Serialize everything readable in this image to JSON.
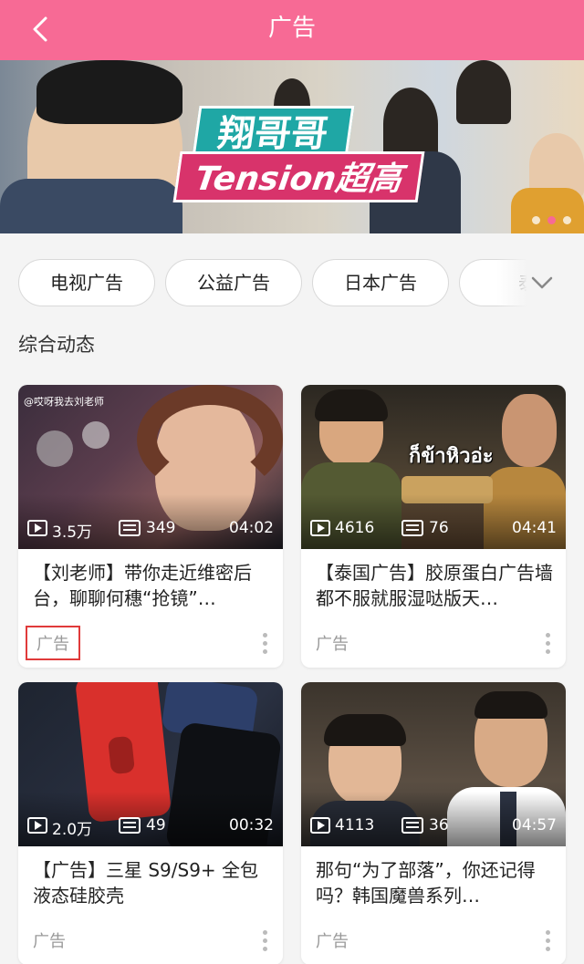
{
  "header": {
    "title": "广告"
  },
  "banner": {
    "logo_line1": "翔哥哥",
    "logo_line2": "Tension超高",
    "slides": 3,
    "active_slide": 2
  },
  "categories": [
    {
      "label": "电视广告"
    },
    {
      "label": "公益广告"
    },
    {
      "label": "日本广告"
    },
    {
      "label": "泰"
    }
  ],
  "section": {
    "title": "综合动态"
  },
  "videos": [
    {
      "plays": "3.5万",
      "comments": "349",
      "duration": "04:02",
      "title": "【刘老师】带你走近维密后台，聊聊何穗“抢镜”…",
      "tag": "广告",
      "watermark": "@哎呀我去刘老师"
    },
    {
      "plays": "4616",
      "comments": "76",
      "duration": "04:41",
      "title": "【泰国广告】胶原蛋白广告墙都不服就服湿哒版天…",
      "tag": "广告",
      "caption": "ก็ข้าหิวอ่ะ"
    },
    {
      "plays": "2.0万",
      "comments": "49",
      "duration": "00:32",
      "title": "【广告】三星 S9/S9+ 全包液态硅胶壳",
      "tag": "广告"
    },
    {
      "plays": "4113",
      "comments": "36",
      "duration": "04:57",
      "title": "那句“为了部落”，你还记得吗？韩国魔兽系列…",
      "tag": "广告"
    }
  ],
  "colors": {
    "accent": "#f76a95",
    "highlight_box": "#e03a3a"
  }
}
